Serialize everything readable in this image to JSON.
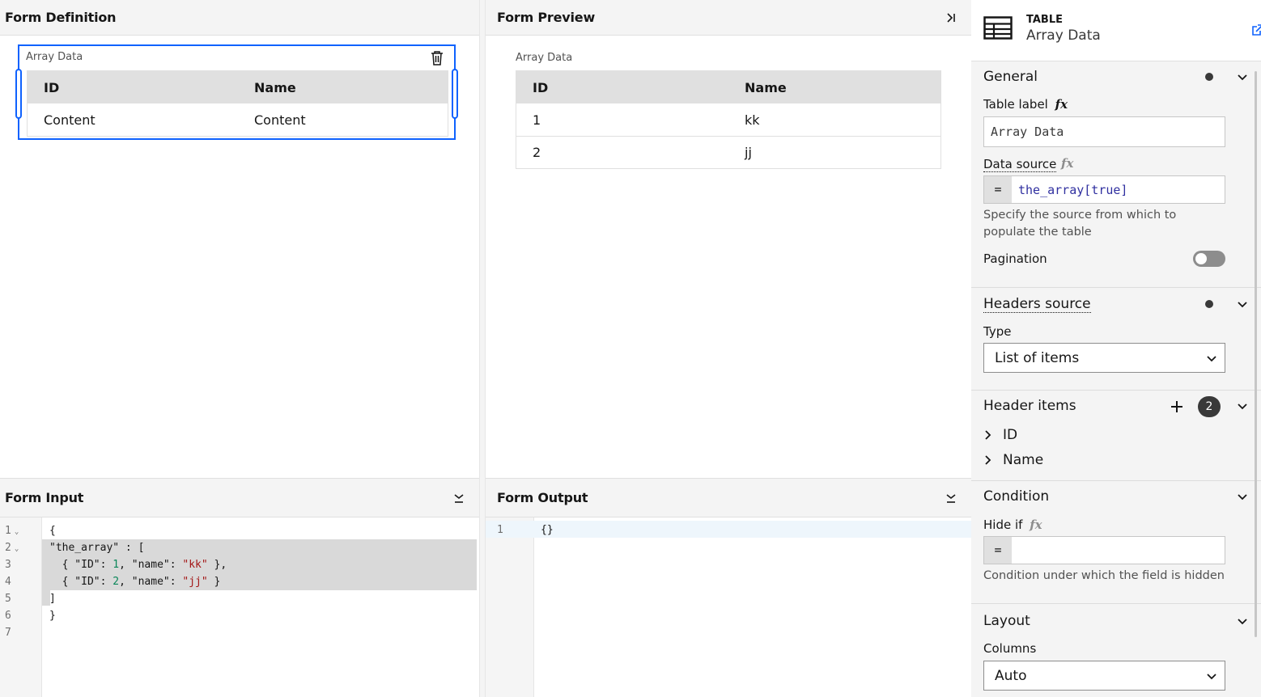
{
  "definition": {
    "title": "Form Definition",
    "component_label": "Array Data",
    "table": {
      "headers": [
        "ID",
        "Name"
      ],
      "row": [
        "Content",
        "Content"
      ]
    }
  },
  "preview": {
    "title": "Form Preview",
    "component_label": "Array Data",
    "table": {
      "headers": [
        "ID",
        "Name"
      ],
      "rows": [
        [
          "1",
          "kk"
        ],
        [
          "2",
          "jj"
        ]
      ]
    }
  },
  "input": {
    "title": "Form Input",
    "line_numbers": [
      "1",
      "2",
      "3",
      "4",
      "5",
      "6",
      "7"
    ],
    "lines": [
      "{",
      "\"the_array\" : [",
      "  { \"ID\": 1, \"name\": \"kk\" },",
      "  { \"ID\": 2, \"name\": \"jj\" }",
      "]",
      "}",
      ""
    ]
  },
  "output": {
    "title": "Form Output",
    "line_numbers": [
      "1"
    ],
    "lines": [
      "{}"
    ]
  },
  "properties": {
    "type_label": "TABLE",
    "component_name": "Array Data",
    "general": {
      "title": "General",
      "table_label_label": "Table label",
      "table_label_value": "Array Data",
      "data_source_label": "Data source",
      "data_source_prefix": "=",
      "data_source_value": "the_array[true]",
      "data_source_helper": "Specify the source from which to populate the table",
      "pagination_label": "Pagination",
      "pagination_on": false
    },
    "headers_source": {
      "title": "Headers source",
      "type_label": "Type",
      "type_value": "List of items"
    },
    "header_items": {
      "title": "Header items",
      "count": "2",
      "items": [
        "ID",
        "Name"
      ]
    },
    "condition": {
      "title": "Condition",
      "hide_if_label": "Hide if",
      "prefix": "=",
      "value": "",
      "helper": "Condition under which the field is hidden"
    },
    "layout": {
      "title": "Layout",
      "columns_label": "Columns",
      "columns_value": "Auto"
    },
    "fx_symbol": "fx"
  },
  "colors": {
    "accent": "#0f62fe",
    "panel_bg": "#f4f4f4"
  }
}
